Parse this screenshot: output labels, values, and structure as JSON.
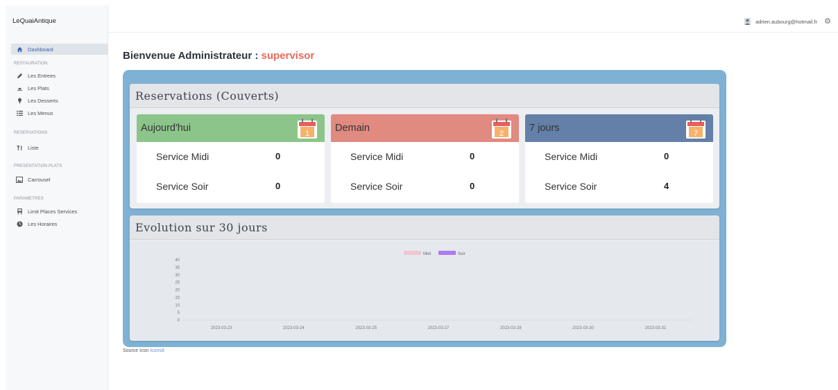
{
  "app": {
    "brand": "LeQuaiAntique"
  },
  "sidebar": {
    "dashboard": "Dashboard",
    "sections": [
      {
        "title": "RESTAURATION",
        "items": [
          "Les Entrees",
          "Les Plats",
          "Les Desserts",
          "Les Menus"
        ]
      },
      {
        "title": "RESERVATIONS",
        "items": [
          "Liste"
        ]
      },
      {
        "title": "PRESENTATION PLATS",
        "items": [
          "Carrousel"
        ]
      },
      {
        "title": "PARAMETRES",
        "items": [
          "Limit Places Services",
          "Les Horaires"
        ]
      }
    ]
  },
  "topbar": {
    "user_email": "adrien.aubourg@hotmail.fr"
  },
  "welcome": {
    "prefix": "Bienvenue Administrateur :",
    "username": "supervisor"
  },
  "reservations": {
    "title": "Reservations (Couverts)",
    "cards": [
      {
        "label": "Aujourd'hui",
        "badge": "1",
        "color": "#8cc58a",
        "midi_label": "Service Midi",
        "midi": "0",
        "soir_label": "Service Soir",
        "soir": "0"
      },
      {
        "label": "Demain",
        "badge": "2",
        "color": "#e08a80",
        "midi_label": "Service Midi",
        "midi": "0",
        "soir_label": "Service Soir",
        "soir": "0"
      },
      {
        "label": "7 jours",
        "badge": "7",
        "color": "#6480a8",
        "midi_label": "Service Midi",
        "midi": "0",
        "soir_label": "Service Soir",
        "soir": "4"
      }
    ]
  },
  "evolution": {
    "title": "Evolution sur 30 jours"
  },
  "chart_data": {
    "type": "bar",
    "categories": [
      "2023-03-23",
      "2023-03-24",
      "2023-03-25",
      "2023-03-27",
      "2023-03-28",
      "2023-03-30",
      "2023-03-31"
    ],
    "series": [
      {
        "name": "Midi",
        "color": "#f1c6cf",
        "values": [
          0,
          0,
          0,
          0,
          0,
          0,
          0
        ]
      },
      {
        "name": "Soir",
        "color": "#b07be8",
        "values": [
          0,
          0,
          0,
          0,
          0,
          0,
          0
        ]
      }
    ],
    "yticks": [
      "40",
      "35",
      "30",
      "25",
      "20",
      "15",
      "10",
      "5",
      "0"
    ],
    "ylim": [
      0,
      40
    ],
    "legend": "top-center"
  },
  "footer": {
    "source_label": "Source Icon",
    "source_link": "Icons8"
  },
  "colors": {
    "accent": "#e86a5a",
    "frame": "#7eb1d3",
    "active_nav": "#3b5ea8"
  }
}
